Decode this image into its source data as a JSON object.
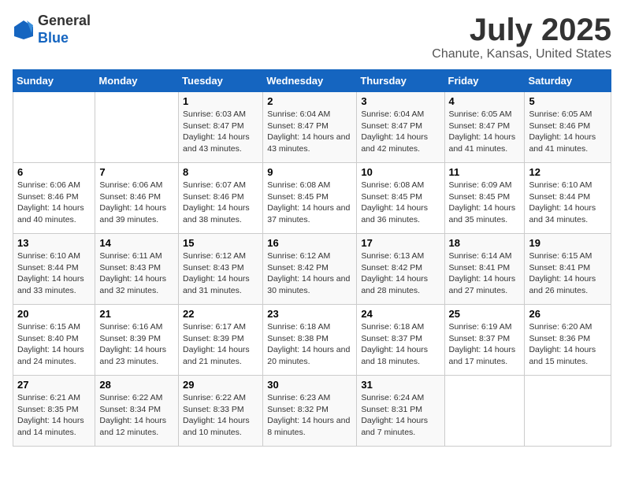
{
  "header": {
    "logo_general": "General",
    "logo_blue": "Blue",
    "main_title": "July 2025",
    "subtitle": "Chanute, Kansas, United States"
  },
  "calendar": {
    "days_of_week": [
      "Sunday",
      "Monday",
      "Tuesday",
      "Wednesday",
      "Thursday",
      "Friday",
      "Saturday"
    ],
    "weeks": [
      [
        {
          "num": "",
          "sunrise": "",
          "sunset": "",
          "daylight": ""
        },
        {
          "num": "",
          "sunrise": "",
          "sunset": "",
          "daylight": ""
        },
        {
          "num": "1",
          "sunrise": "Sunrise: 6:03 AM",
          "sunset": "Sunset: 8:47 PM",
          "daylight": "Daylight: 14 hours and 43 minutes."
        },
        {
          "num": "2",
          "sunrise": "Sunrise: 6:04 AM",
          "sunset": "Sunset: 8:47 PM",
          "daylight": "Daylight: 14 hours and 43 minutes."
        },
        {
          "num": "3",
          "sunrise": "Sunrise: 6:04 AM",
          "sunset": "Sunset: 8:47 PM",
          "daylight": "Daylight: 14 hours and 42 minutes."
        },
        {
          "num": "4",
          "sunrise": "Sunrise: 6:05 AM",
          "sunset": "Sunset: 8:47 PM",
          "daylight": "Daylight: 14 hours and 41 minutes."
        },
        {
          "num": "5",
          "sunrise": "Sunrise: 6:05 AM",
          "sunset": "Sunset: 8:46 PM",
          "daylight": "Daylight: 14 hours and 41 minutes."
        }
      ],
      [
        {
          "num": "6",
          "sunrise": "Sunrise: 6:06 AM",
          "sunset": "Sunset: 8:46 PM",
          "daylight": "Daylight: 14 hours and 40 minutes."
        },
        {
          "num": "7",
          "sunrise": "Sunrise: 6:06 AM",
          "sunset": "Sunset: 8:46 PM",
          "daylight": "Daylight: 14 hours and 39 minutes."
        },
        {
          "num": "8",
          "sunrise": "Sunrise: 6:07 AM",
          "sunset": "Sunset: 8:46 PM",
          "daylight": "Daylight: 14 hours and 38 minutes."
        },
        {
          "num": "9",
          "sunrise": "Sunrise: 6:08 AM",
          "sunset": "Sunset: 8:45 PM",
          "daylight": "Daylight: 14 hours and 37 minutes."
        },
        {
          "num": "10",
          "sunrise": "Sunrise: 6:08 AM",
          "sunset": "Sunset: 8:45 PM",
          "daylight": "Daylight: 14 hours and 36 minutes."
        },
        {
          "num": "11",
          "sunrise": "Sunrise: 6:09 AM",
          "sunset": "Sunset: 8:45 PM",
          "daylight": "Daylight: 14 hours and 35 minutes."
        },
        {
          "num": "12",
          "sunrise": "Sunrise: 6:10 AM",
          "sunset": "Sunset: 8:44 PM",
          "daylight": "Daylight: 14 hours and 34 minutes."
        }
      ],
      [
        {
          "num": "13",
          "sunrise": "Sunrise: 6:10 AM",
          "sunset": "Sunset: 8:44 PM",
          "daylight": "Daylight: 14 hours and 33 minutes."
        },
        {
          "num": "14",
          "sunrise": "Sunrise: 6:11 AM",
          "sunset": "Sunset: 8:43 PM",
          "daylight": "Daylight: 14 hours and 32 minutes."
        },
        {
          "num": "15",
          "sunrise": "Sunrise: 6:12 AM",
          "sunset": "Sunset: 8:43 PM",
          "daylight": "Daylight: 14 hours and 31 minutes."
        },
        {
          "num": "16",
          "sunrise": "Sunrise: 6:12 AM",
          "sunset": "Sunset: 8:42 PM",
          "daylight": "Daylight: 14 hours and 30 minutes."
        },
        {
          "num": "17",
          "sunrise": "Sunrise: 6:13 AM",
          "sunset": "Sunset: 8:42 PM",
          "daylight": "Daylight: 14 hours and 28 minutes."
        },
        {
          "num": "18",
          "sunrise": "Sunrise: 6:14 AM",
          "sunset": "Sunset: 8:41 PM",
          "daylight": "Daylight: 14 hours and 27 minutes."
        },
        {
          "num": "19",
          "sunrise": "Sunrise: 6:15 AM",
          "sunset": "Sunset: 8:41 PM",
          "daylight": "Daylight: 14 hours and 26 minutes."
        }
      ],
      [
        {
          "num": "20",
          "sunrise": "Sunrise: 6:15 AM",
          "sunset": "Sunset: 8:40 PM",
          "daylight": "Daylight: 14 hours and 24 minutes."
        },
        {
          "num": "21",
          "sunrise": "Sunrise: 6:16 AM",
          "sunset": "Sunset: 8:39 PM",
          "daylight": "Daylight: 14 hours and 23 minutes."
        },
        {
          "num": "22",
          "sunrise": "Sunrise: 6:17 AM",
          "sunset": "Sunset: 8:39 PM",
          "daylight": "Daylight: 14 hours and 21 minutes."
        },
        {
          "num": "23",
          "sunrise": "Sunrise: 6:18 AM",
          "sunset": "Sunset: 8:38 PM",
          "daylight": "Daylight: 14 hours and 20 minutes."
        },
        {
          "num": "24",
          "sunrise": "Sunrise: 6:18 AM",
          "sunset": "Sunset: 8:37 PM",
          "daylight": "Daylight: 14 hours and 18 minutes."
        },
        {
          "num": "25",
          "sunrise": "Sunrise: 6:19 AM",
          "sunset": "Sunset: 8:37 PM",
          "daylight": "Daylight: 14 hours and 17 minutes."
        },
        {
          "num": "26",
          "sunrise": "Sunrise: 6:20 AM",
          "sunset": "Sunset: 8:36 PM",
          "daylight": "Daylight: 14 hours and 15 minutes."
        }
      ],
      [
        {
          "num": "27",
          "sunrise": "Sunrise: 6:21 AM",
          "sunset": "Sunset: 8:35 PM",
          "daylight": "Daylight: 14 hours and 14 minutes."
        },
        {
          "num": "28",
          "sunrise": "Sunrise: 6:22 AM",
          "sunset": "Sunset: 8:34 PM",
          "daylight": "Daylight: 14 hours and 12 minutes."
        },
        {
          "num": "29",
          "sunrise": "Sunrise: 6:22 AM",
          "sunset": "Sunset: 8:33 PM",
          "daylight": "Daylight: 14 hours and 10 minutes."
        },
        {
          "num": "30",
          "sunrise": "Sunrise: 6:23 AM",
          "sunset": "Sunset: 8:32 PM",
          "daylight": "Daylight: 14 hours and 8 minutes."
        },
        {
          "num": "31",
          "sunrise": "Sunrise: 6:24 AM",
          "sunset": "Sunset: 8:31 PM",
          "daylight": "Daylight: 14 hours and 7 minutes."
        },
        {
          "num": "",
          "sunrise": "",
          "sunset": "",
          "daylight": ""
        },
        {
          "num": "",
          "sunrise": "",
          "sunset": "",
          "daylight": ""
        }
      ]
    ]
  }
}
